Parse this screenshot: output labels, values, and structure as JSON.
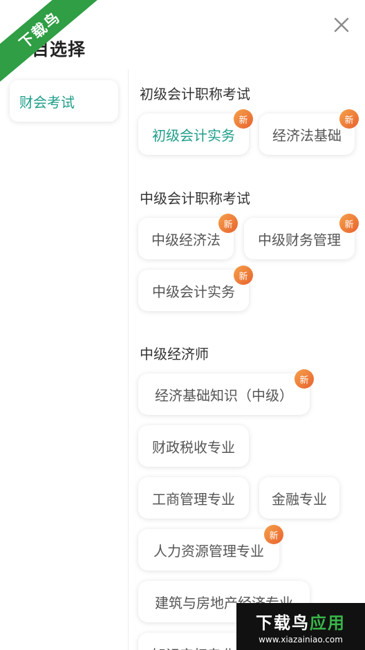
{
  "page": {
    "title": "科目选择"
  },
  "corner_badge": {
    "text": "下载鸟"
  },
  "sidebar": {
    "items": [
      {
        "label": "财会考试",
        "selected": true
      }
    ]
  },
  "badge_text": "新",
  "sections": [
    {
      "title": "初级会计职称考试",
      "items": [
        {
          "label": "初级会计实务",
          "is_new": true,
          "selected": true
        },
        {
          "label": "经济法基础",
          "is_new": true
        }
      ]
    },
    {
      "title": "中级会计职称考试",
      "items": [
        {
          "label": "中级经济法",
          "is_new": true
        },
        {
          "label": "中级财务管理",
          "is_new": true
        },
        {
          "label": "中级会计实务",
          "is_new": true
        }
      ]
    },
    {
      "title": "中级经济师",
      "items": [
        {
          "label": "经济基础知识（中级）",
          "is_new": true
        },
        {
          "label": "财政税收专业"
        },
        {
          "label": "工商管理专业"
        },
        {
          "label": "金融专业"
        },
        {
          "label": "人力资源管理专业",
          "is_new": true
        },
        {
          "label": "建筑与房地产经济专业"
        },
        {
          "label": "知识产权专业"
        }
      ]
    }
  ],
  "watermark": {
    "brand_a": "下载鸟",
    "brand_b": "应用",
    "url": "www.xiazainiao.com"
  },
  "colors": {
    "accent": "#1f9e8a",
    "badge": "#e8612e",
    "corner_green": "#2f9e44"
  }
}
